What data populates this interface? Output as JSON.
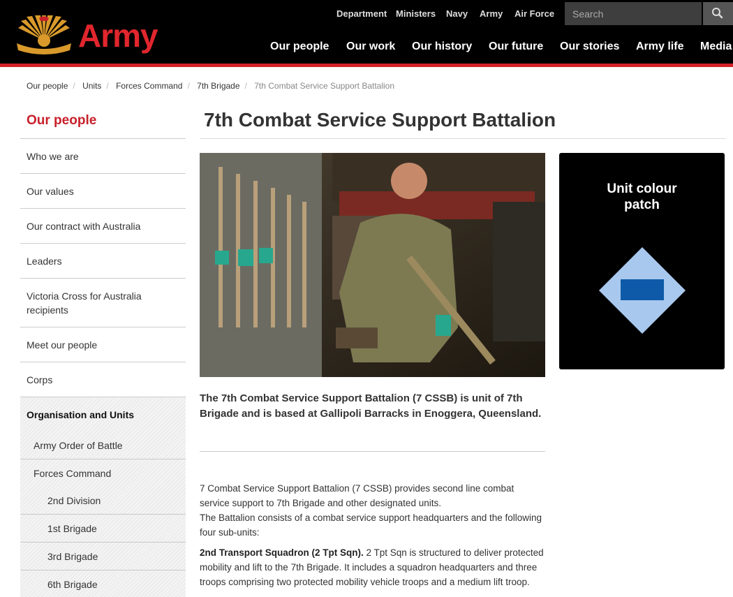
{
  "header": {
    "brand": "Army",
    "util_nav": [
      "Department",
      "Ministers",
      "Navy",
      "Army",
      "Air Force"
    ],
    "search_placeholder": "Search",
    "main_nav": [
      "Our people",
      "Our work",
      "Our history",
      "Our future",
      "Our stories",
      "Army life",
      "Media"
    ]
  },
  "breadcrumb": [
    "Our people",
    "Units",
    "Forces Command",
    "7th Brigade",
    "7th Combat Service Support Battalion"
  ],
  "sidebar": {
    "title": "Our people",
    "items": [
      "Who we are",
      "Our values",
      "Our contract with Australia",
      "Leaders",
      "Victoria Cross for Australia recipients",
      "Meet our people",
      "Corps"
    ],
    "section": "Organisation and Units",
    "sub_items": [
      "Army Order of Battle",
      "Forces Command"
    ],
    "sub_sub_items": [
      "2nd Division",
      "1st Brigade",
      "3rd Brigade",
      "6th Brigade"
    ]
  },
  "page": {
    "title": "7th Combat Service Support Battalion",
    "intro": "The 7th Combat Service Support Battalion (7 CSSB) is unit of 7th Brigade and is based at Gallipoli Barracks in Enoggera, Queensland.",
    "para1": "7 Combat Service Support Battalion (7 CSSB) provides second line combat service support to 7th Brigade and other designated units.",
    "para2": "The Battalion consists of a combat service support headquarters and the following four sub-units:",
    "para3_bold": "2nd Transport Squadron (2 Tpt Sqn).",
    "para3": " 2 Tpt Sqn is structured to deliver protected mobility and lift to the 7th Brigade. It includes a squadron headquarters and three troops comprising two protected mobility vehicle troops and a medium lift troop."
  },
  "patch": {
    "title": "Unit colour\npatch",
    "diamond_color": "#a8c8ee",
    "bar_color": "#0e5aa8"
  },
  "colors": {
    "brand_red": "#e1262d",
    "header_bg": "#000000"
  },
  "icons": [
    "rising-sun-badge-icon",
    "search-icon"
  ]
}
